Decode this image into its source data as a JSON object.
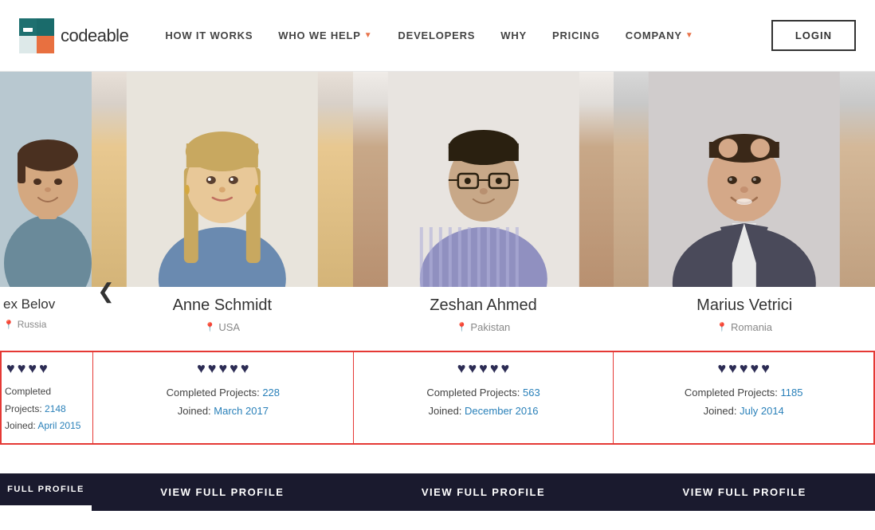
{
  "header": {
    "logo_text": "codeable",
    "nav_items": [
      {
        "label": "HOW IT WORKS",
        "has_dropdown": false
      },
      {
        "label": "WHO WE HELP",
        "has_dropdown": true
      },
      {
        "label": "DEVELOPERS",
        "has_dropdown": false
      },
      {
        "label": "WHY",
        "has_dropdown": false
      },
      {
        "label": "PRICING",
        "has_dropdown": false
      },
      {
        "label": "COMPANY",
        "has_dropdown": true
      }
    ],
    "login_label": "LOGIN"
  },
  "carousel": {
    "arrow_left": "❮",
    "profiles": [
      {
        "id": "alex",
        "name": "ex Belov",
        "location": "Russia",
        "hearts": 4,
        "max_hearts": 4,
        "completed_projects_label": "Completed Projects:",
        "completed_projects": "2148",
        "joined_label": "Joined:",
        "joined": "April 2015",
        "btn_label": "FULL PROFILE",
        "partial": true
      },
      {
        "id": "anne",
        "name": "Anne Schmidt",
        "location": "USA",
        "hearts": 5,
        "max_hearts": 5,
        "completed_projects_label": "Completed Projects:",
        "completed_projects": "228",
        "joined_label": "Joined:",
        "joined": "March 2017",
        "btn_label": "VIEW FULL PROFILE",
        "partial": false
      },
      {
        "id": "zeshan",
        "name": "Zeshan Ahmed",
        "location": "Pakistan",
        "hearts": 5,
        "max_hearts": 5,
        "completed_projects_label": "Completed Projects:",
        "completed_projects": "563",
        "joined_label": "Joined:",
        "joined": "December 2016",
        "btn_label": "VIEW FULL PROFILE",
        "partial": false
      },
      {
        "id": "marius",
        "name": "Marius Vetrici",
        "location": "Romania",
        "hearts": 5,
        "max_hearts": 5,
        "completed_projects_label": "Completed Projects:",
        "completed_projects": "1185",
        "joined_label": "Joined:",
        "joined": "July 2014",
        "btn_label": "VIEW FULL PROFILE",
        "partial": false
      }
    ],
    "colors": {
      "highlight_border": "#e53935",
      "btn_bg": "#1a1a2e",
      "heart_color": "#1a1a2e",
      "stat_link_color": "#2980b9"
    }
  }
}
